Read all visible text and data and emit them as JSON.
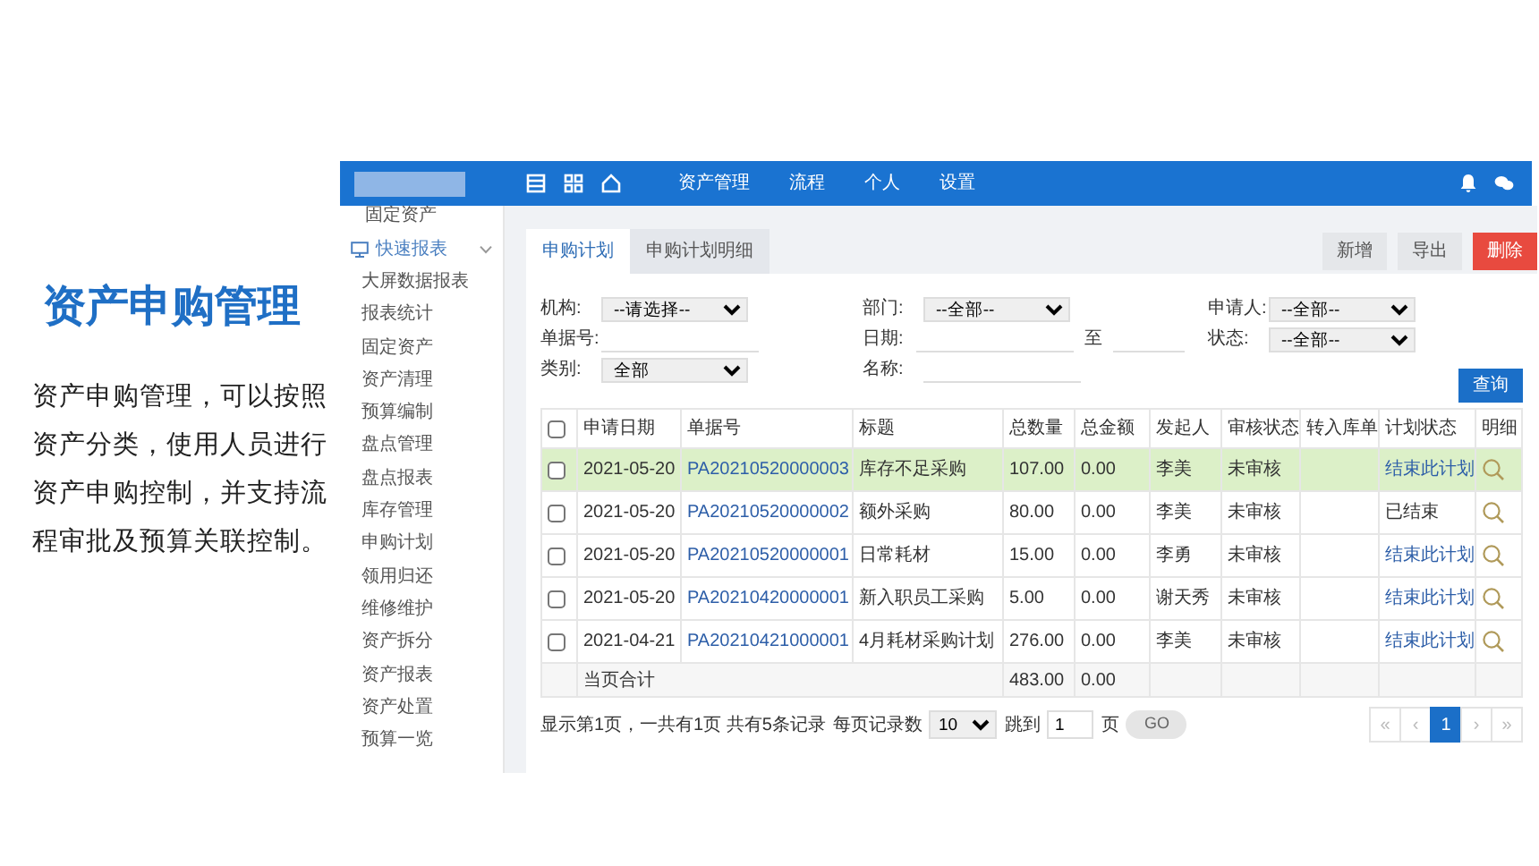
{
  "intro": {
    "title": "资产申购管理",
    "text": "资产申购管理，可以按照资产分类，使用人员进行资产申购控制，并支持流程审批及预算关联控制。"
  },
  "topbar": {
    "menu": [
      {
        "label": "资产管理"
      },
      {
        "label": "流程"
      },
      {
        "label": "个人"
      },
      {
        "label": "设置"
      }
    ]
  },
  "sidebar": {
    "items": [
      {
        "label": "固定资产"
      },
      {
        "label": "快速报表",
        "expanded": true,
        "children": [
          {
            "label": "大屏数据报表"
          },
          {
            "label": "报表统计"
          },
          {
            "label": "固定资产"
          },
          {
            "label": "资产清理"
          },
          {
            "label": "预算编制"
          },
          {
            "label": "盘点管理"
          },
          {
            "label": "盘点报表"
          },
          {
            "label": "库存管理"
          },
          {
            "label": "申购计划"
          },
          {
            "label": "领用归还"
          },
          {
            "label": "维修维护"
          },
          {
            "label": "资产拆分"
          },
          {
            "label": "资产报表"
          },
          {
            "label": "资产处置"
          },
          {
            "label": "预算一览"
          }
        ]
      }
    ]
  },
  "tabs": [
    {
      "label": "申购计划",
      "selected": true
    },
    {
      "label": "申购计划明细",
      "selected": false
    }
  ],
  "toolbar_buttons": [
    {
      "label": "新增",
      "kind": "default"
    },
    {
      "label": "导出",
      "kind": "default"
    },
    {
      "label": "删除",
      "kind": "danger"
    }
  ],
  "filters": [
    {
      "label": "机构:",
      "kind": "select",
      "value": "--请选择--"
    },
    {
      "label": "部门:",
      "kind": "select",
      "value": "--全部--"
    },
    {
      "label": "申请人:",
      "kind": "select",
      "value": "--全部--"
    },
    {
      "label": "单据号:",
      "kind": "input"
    },
    {
      "label": "日期:",
      "kind": "daterange",
      "separator": "至"
    },
    {
      "label": "状态:",
      "kind": "select",
      "value": "--全部--"
    },
    {
      "label": "类别:",
      "kind": "select",
      "value": "全部"
    },
    {
      "label": "名称:",
      "kind": "input"
    }
  ],
  "search_button": "查询",
  "table": {
    "select_all_checked": false,
    "columns": [
      "申请日期",
      "单据号",
      "标题",
      "总数量",
      "总金额",
      "发起人",
      "审核状态",
      "转入库单",
      "计划状态",
      "明细"
    ],
    "rows": [
      {
        "checked": false,
        "selected": true,
        "date": "2021-05-20",
        "number": "PA20210520000003",
        "title": "库存不足采购",
        "qty": "107.00",
        "amount": "0.00",
        "initiator": "李美",
        "audit": "未审核",
        "stock_in": "",
        "plan_status": {
          "text": "结束此计划",
          "kind": "link"
        }
      },
      {
        "checked": false,
        "selected": false,
        "date": "2021-05-20",
        "number": "PA20210520000002",
        "title": "额外采购",
        "qty": "80.00",
        "amount": "0.00",
        "initiator": "李美",
        "audit": "未审核",
        "stock_in": "",
        "plan_status": {
          "text": "已结束",
          "kind": "text"
        }
      },
      {
        "checked": false,
        "selected": false,
        "date": "2021-05-20",
        "number": "PA20210520000001",
        "title": "日常耗材",
        "qty": "15.00",
        "amount": "0.00",
        "initiator": "李勇",
        "audit": "未审核",
        "stock_in": "",
        "plan_status": {
          "text": "结束此计划",
          "kind": "link"
        }
      },
      {
        "checked": false,
        "selected": false,
        "date": "2021-05-20",
        "number": "PA20210420000001",
        "title": "新入职员工采购",
        "qty": "5.00",
        "amount": "0.00",
        "initiator": "谢天秀",
        "audit": "未审核",
        "stock_in": "",
        "plan_status": {
          "text": "结束此计划",
          "kind": "link"
        }
      },
      {
        "checked": false,
        "selected": false,
        "date": "2021-04-21",
        "number": "PA20210421000001",
        "title": "4月耗材采购计划",
        "qty": "276.00",
        "amount": "0.00",
        "initiator": "李美",
        "audit": "未审核",
        "stock_in": "",
        "plan_status": {
          "text": "结束此计划",
          "kind": "link"
        }
      }
    ],
    "totals": {
      "label": "当页合计",
      "qty": "483.00",
      "amount": "0.00"
    }
  },
  "footer": {
    "info": "显示第1页，一共有1页 共有5条记录",
    "page_size_label": "每页记录数",
    "page_size": "10",
    "jump_label": "跳到",
    "jump_value": "1",
    "page_unit": "页",
    "go": "GO",
    "pager": [
      {
        "label": "«",
        "selected": false
      },
      {
        "label": "‹",
        "selected": false
      },
      {
        "label": "1",
        "selected": true
      },
      {
        "label": "›",
        "selected": false
      },
      {
        "label": "»",
        "selected": false
      }
    ]
  }
}
